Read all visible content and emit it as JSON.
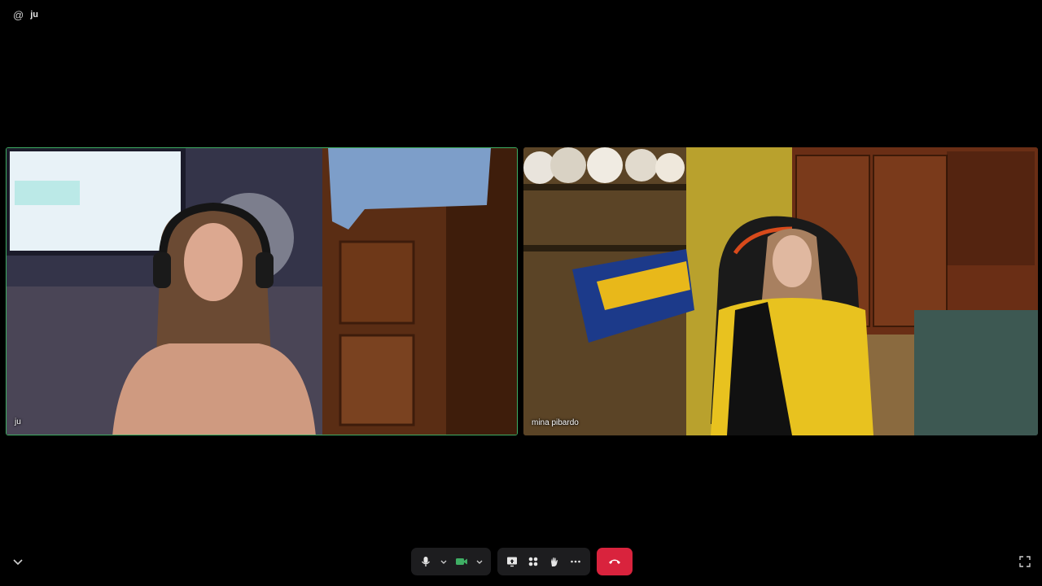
{
  "header": {
    "at_symbol": "@",
    "user_name": "ju"
  },
  "participants": [
    {
      "name": "ju",
      "active_speaker": true
    },
    {
      "name": "mina pibardo",
      "active_speaker": false
    }
  ],
  "controls": {
    "mic_icon": "microphone-icon",
    "camera_icon": "video-camera-icon",
    "camera_color": "#3fae64",
    "share_icon": "screen-share-icon",
    "apps_icon": "apps-grid-icon",
    "reactions_icon": "raise-hand-icon",
    "more_icon": "more-options-icon",
    "leave_icon": "hang-up-icon",
    "leave_color": "#d9233d"
  },
  "colors": {
    "active_border": "#3fae64",
    "background": "#000000"
  }
}
